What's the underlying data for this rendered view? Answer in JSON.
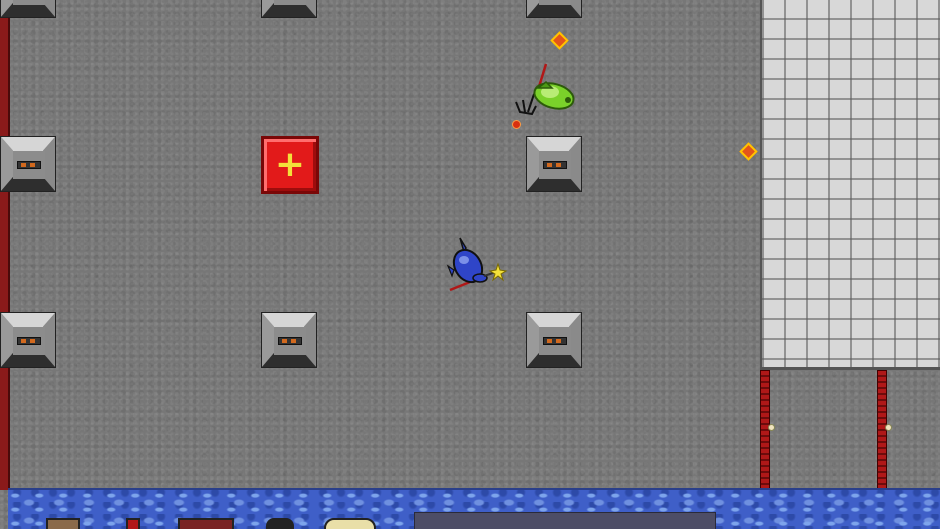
{
  "scene": {
    "title": "",
    "floor": "grey-stone-floor",
    "right_wall": "light-brick-wall",
    "bottom_hazard": "water"
  },
  "entities": {
    "player": {
      "name": "blue-wizard-ship",
      "weapon": "star-wand"
    },
    "enemy": {
      "name": "green-witch-ship",
      "weapon": "trident"
    },
    "pickup": {
      "name": "health-pack",
      "symbol": "+"
    }
  },
  "turrets": [
    {
      "name": "turret"
    },
    {
      "name": "turret"
    },
    {
      "name": "turret"
    },
    {
      "name": "turret"
    },
    {
      "name": "turret"
    },
    {
      "name": "turret"
    },
    {
      "name": "turret"
    },
    {
      "name": "turret"
    }
  ],
  "projectiles": [
    {
      "name": "fire-spark"
    },
    {
      "name": "fire-spark"
    },
    {
      "name": "fire-ember"
    }
  ],
  "colors": {
    "floor": "#777777",
    "wall": "#8a1a1a",
    "health": "#e21a1a",
    "plus": "#f3e13a",
    "water": "#3f5fc8",
    "player": "#2f45c8",
    "enemy": "#7ad12a"
  }
}
